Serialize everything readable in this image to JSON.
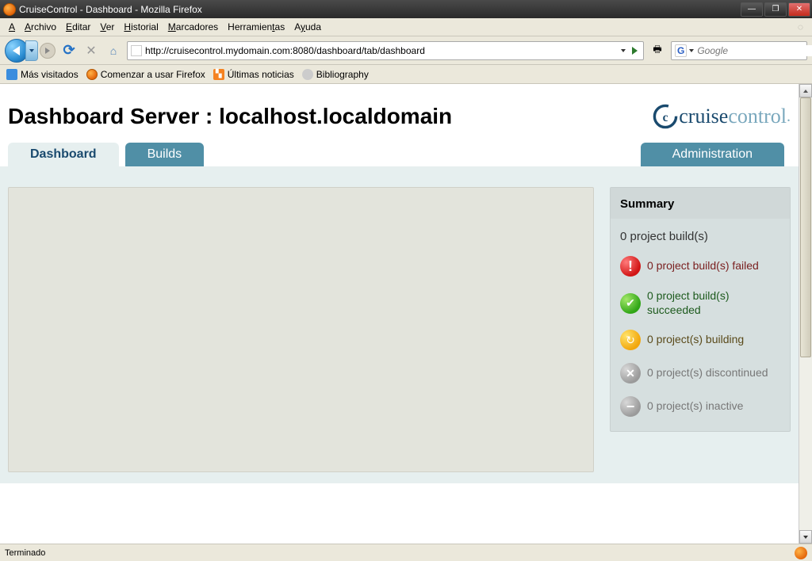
{
  "window": {
    "title": "CruiseControl - Dashboard - Mozilla Firefox"
  },
  "menu": {
    "archivo": "Archivo",
    "editar": "Editar",
    "ver": "Ver",
    "historial": "Historial",
    "marcadores": "Marcadores",
    "herramientas": "Herramientas",
    "ayuda": "Ayuda"
  },
  "nav": {
    "url": "http://cruisecontrol.mydomain.com:8080/dashboard/tab/dashboard",
    "search_placeholder": "Google"
  },
  "bookmarks": {
    "mas_visitados": "Más visitados",
    "comenzar": "Comenzar a usar Firefox",
    "ultimas": "Últimas noticias",
    "bibliography": "Bibliography"
  },
  "page": {
    "heading": "Dashboard Server : localhost.localdomain",
    "logo_text": "cruisecontrol"
  },
  "tabs": {
    "dashboard": "Dashboard",
    "builds": "Builds",
    "administration": "Administration"
  },
  "summary": {
    "title": "Summary",
    "total": "0 project build(s)",
    "failed": "0 project build(s) failed",
    "succeeded": "0 project build(s) succeeded",
    "building": "0 project(s) building",
    "discontinued": "0 project(s) discontinued",
    "inactive": "0 project(s) inactive"
  },
  "status": {
    "text": "Terminado"
  }
}
